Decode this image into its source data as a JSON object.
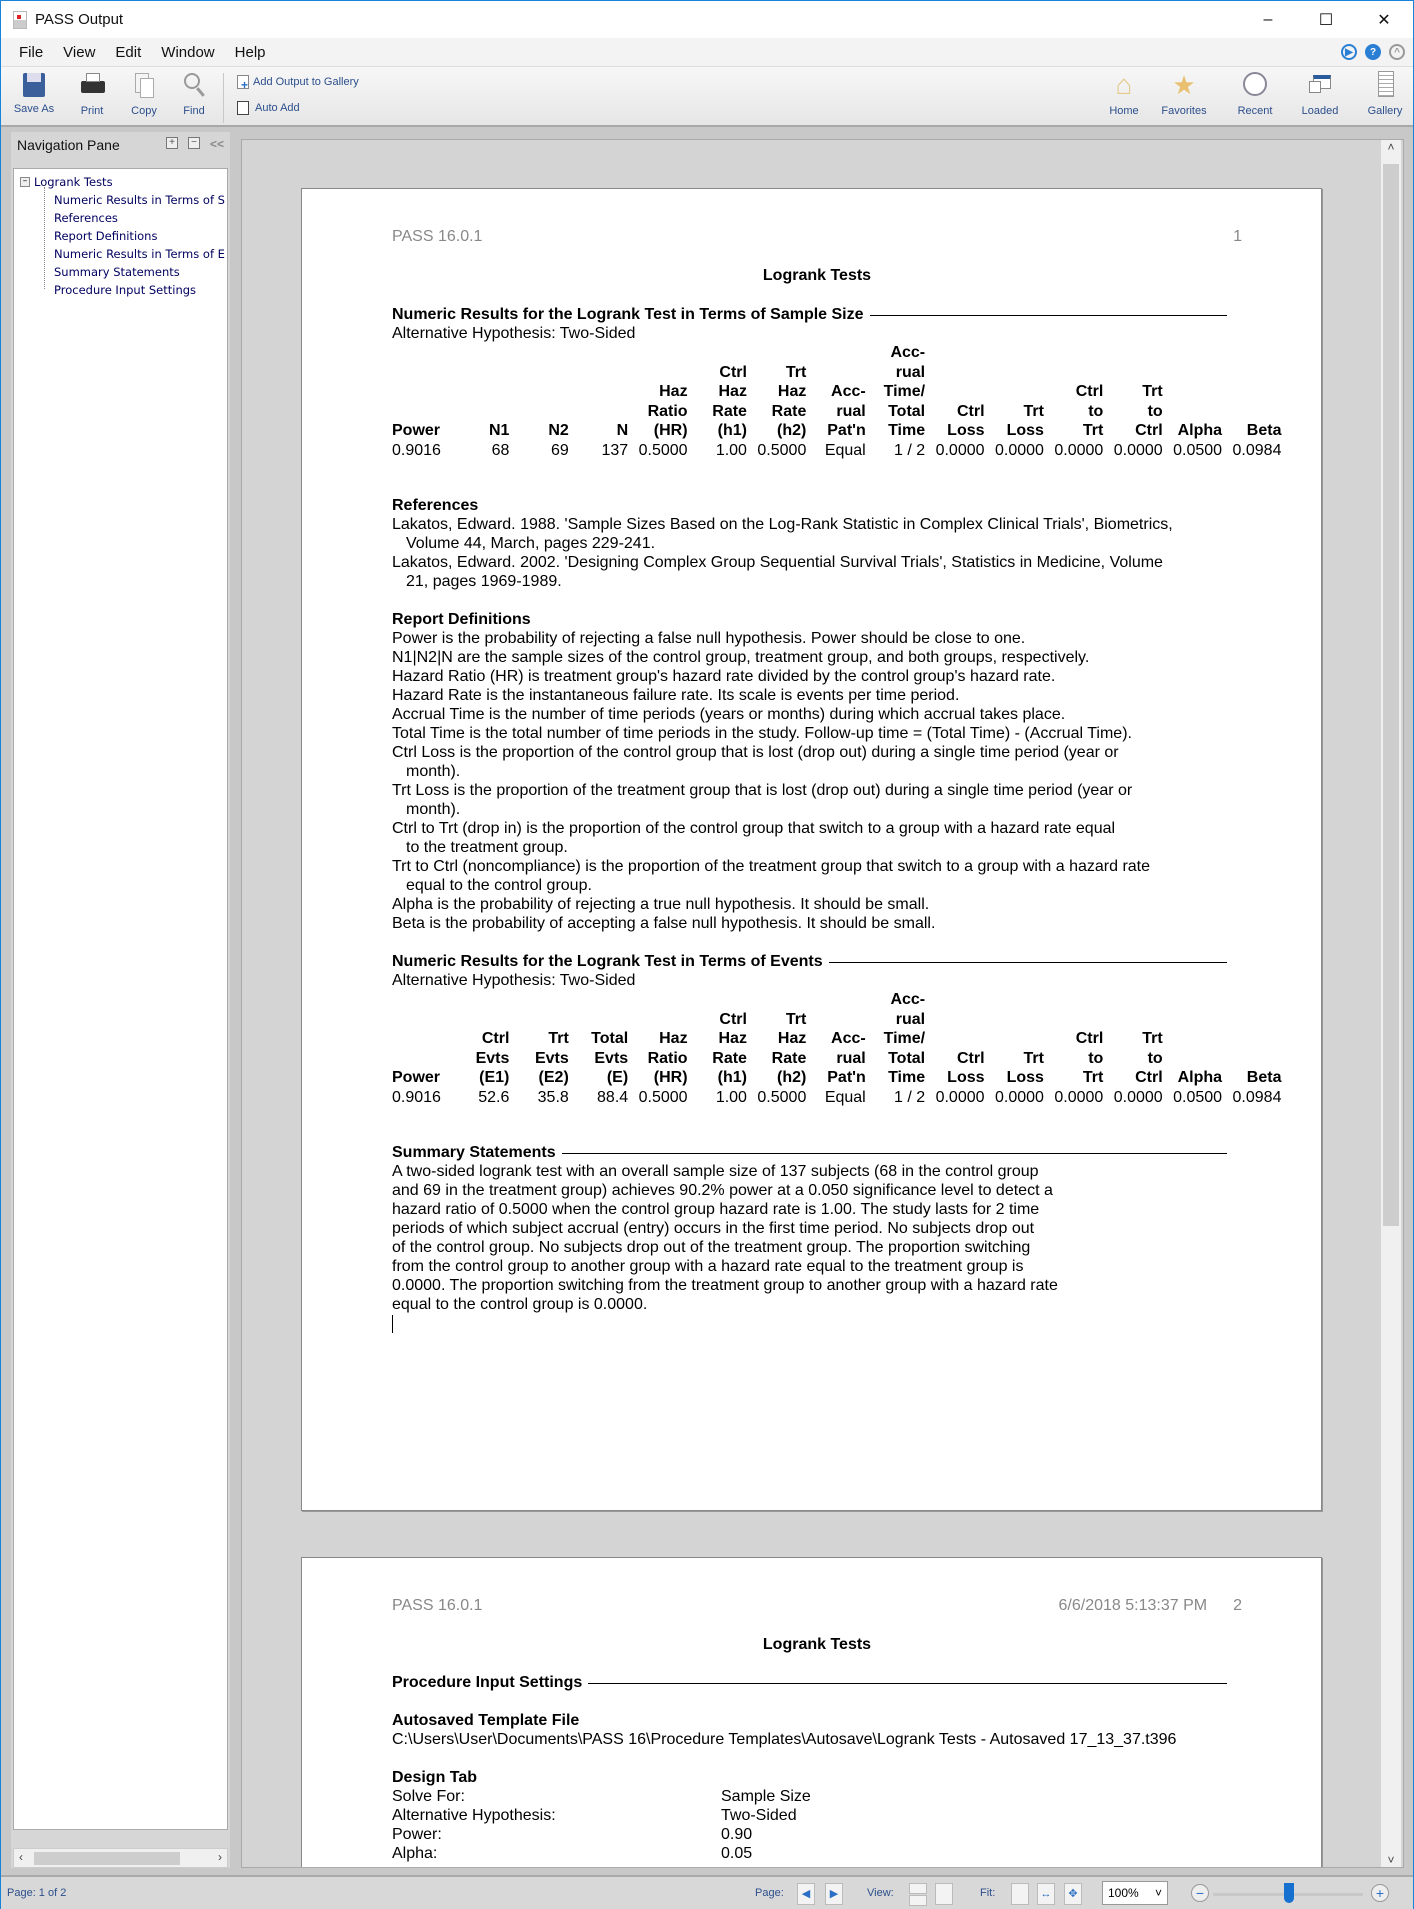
{
  "window": {
    "title": "PASS Output",
    "minimize": "–",
    "maximize": "☐",
    "close": "✕"
  },
  "menu": [
    "File",
    "View",
    "Edit",
    "Window",
    "Help"
  ],
  "toolbar": {
    "save_as": "Save As",
    "print": "Print",
    "copy": "Copy",
    "find": "Find",
    "add_output": "Add Output to Gallery",
    "auto_add": "Auto Add",
    "auto_add_checked": false,
    "home": "Home",
    "favorites": "Favorites",
    "recent": "Recent",
    "loaded": "Loaded",
    "gallery": "Gallery"
  },
  "nav": {
    "title": "Navigation Pane",
    "collapse": "<<",
    "root": "Logrank Tests",
    "items": [
      "Numeric Results in Terms of S",
      "References",
      "Report Definitions",
      "Numeric Results in Terms of E",
      "Summary Statements",
      "Procedure Input Settings"
    ]
  },
  "page1": {
    "version": "PASS 16.0.1",
    "page_num": "1",
    "title": "Logrank Tests",
    "sec1": "Numeric Results for the Logrank Test in Terms of Sample Size",
    "alt1": "Alternative Hypothesis: Two-Sided",
    "table1": {
      "headers": [
        "Power",
        "N1",
        "N2",
        "N",
        "Haz\nRatio\n(HR)",
        "Ctrl\nHaz\nRate\n(h1)",
        "Trt\nHaz\nRate\n(h2)",
        "Acc-\nrual\nPat'n",
        "Acc-\nrual\nTime/\nTotal\nTime",
        "Ctrl\nLoss",
        "Trt\nLoss",
        "Ctrl\nto\nTrt",
        "Trt\nto\nCtrl",
        "Alpha",
        "Beta"
      ],
      "row": [
        "0.9016",
        "68",
        "69",
        "137",
        "0.5000",
        "1.00",
        "0.5000",
        "Equal",
        "1 / 2",
        "0.0000",
        "0.0000",
        "0.0000",
        "0.0000",
        "0.0500",
        "0.0984"
      ]
    },
    "references_title": "References",
    "references": [
      {
        "text": "Lakatos, Edward. 1988. 'Sample Sizes Based on the Log-Rank Statistic in Complex Clinical Trials', Biometrics,",
        "indent": false
      },
      {
        "text": "Volume 44, March, pages 229-241.",
        "indent": true
      },
      {
        "text": "Lakatos, Edward. 2002. 'Designing Complex Group Sequential Survival Trials', Statistics in Medicine, Volume",
        "indent": false
      },
      {
        "text": "21, pages 1969-1989.",
        "indent": true
      }
    ],
    "defs_title": "Report Definitions",
    "defs": [
      {
        "text": "Power is the probability of rejecting a false null hypothesis. Power should be close to one.",
        "indent": false
      },
      {
        "text": "N1|N2|N are the sample sizes of the control group, treatment group, and both groups, respectively.",
        "indent": false
      },
      {
        "text": "Hazard Ratio (HR) is treatment group's hazard rate divided by the control group's hazard rate.",
        "indent": false
      },
      {
        "text": "Hazard Rate is the instantaneous failure rate. Its scale is events per time period.",
        "indent": false
      },
      {
        "text": "Accrual Time is the number of time periods (years or months) during which accrual takes place.",
        "indent": false
      },
      {
        "text": "Total Time is the total number of time periods in the study. Follow-up time = (Total Time) - (Accrual Time).",
        "indent": false
      },
      {
        "text": "Ctrl Loss is the proportion of the control group that is lost (drop out) during a single time period (year or",
        "indent": false
      },
      {
        "text": "month).",
        "indent": true
      },
      {
        "text": "Trt Loss is the proportion of the treatment group that is lost (drop out) during a single time period (year or",
        "indent": false
      },
      {
        "text": "month).",
        "indent": true
      },
      {
        "text": "Ctrl to Trt (drop in) is the proportion of the control group that switch to a group with a hazard rate equal",
        "indent": false
      },
      {
        "text": "to the treatment group.",
        "indent": true
      },
      {
        "text": "Trt to Ctrl (noncompliance) is the proportion of the treatment group that switch to a group with a hazard rate",
        "indent": false
      },
      {
        "text": "equal to the control group.",
        "indent": true
      },
      {
        "text": "Alpha is the probability of rejecting a true null hypothesis. It should be small.",
        "indent": false
      },
      {
        "text": "Beta is the probability of accepting a false null hypothesis. It should be small.",
        "indent": false
      }
    ],
    "sec2": "Numeric Results for the Logrank Test in Terms of Events",
    "alt2": "Alternative Hypothesis: Two-Sided",
    "table2": {
      "headers": [
        "Power",
        "Ctrl\nEvts\n(E1)",
        "Trt\nEvts\n(E2)",
        "Total\nEvts\n(E)",
        "Haz\nRatio\n(HR)",
        "Ctrl\nHaz\nRate\n(h1)",
        "Trt\nHaz\nRate\n(h2)",
        "Acc-\nrual\nPat'n",
        "Acc-\nrual\nTime/\nTotal\nTime",
        "Ctrl\nLoss",
        "Trt\nLoss",
        "Ctrl\nto\nTrt",
        "Trt\nto\nCtrl",
        "Alpha",
        "Beta"
      ],
      "row": [
        "0.9016",
        "52.6",
        "35.8",
        "88.4",
        "0.5000",
        "1.00",
        "0.5000",
        "Equal",
        "1 / 2",
        "0.0000",
        "0.0000",
        "0.0000",
        "0.0000",
        "0.0500",
        "0.0984"
      ]
    },
    "summary_title": "Summary Statements",
    "summary": [
      "A two-sided logrank test with an overall sample size of 137 subjects (68 in the control group",
      "and 69 in the treatment group) achieves 90.2% power at a 0.050 significance level to detect a",
      "hazard ratio of 0.5000 when the control group hazard rate is 1.00. The study lasts for 2 time",
      "periods of which subject accrual (entry) occurs in the first time period. No subjects drop out",
      "of the control group. No subjects drop out of the treatment group. The proportion switching",
      "from the control group to another group with a hazard rate equal to the treatment group is",
      "0.0000. The proportion switching from the treatment group to another group with a hazard rate",
      "equal to the control group is 0.0000."
    ]
  },
  "page2": {
    "version": "PASS 16.0.1",
    "datetime": "6/6/2018 5:13:37 PM",
    "page_num": "2",
    "title": "Logrank Tests",
    "sec": "Procedure Input Settings",
    "template_title": "Autosaved Template File",
    "template_path": "C:\\Users\\User\\Documents\\PASS 16\\Procedure Templates\\Autosave\\Logrank Tests - Autosaved 17_13_37.t396",
    "design_title": "Design Tab",
    "design": [
      {
        "k": "Solve For:",
        "v": "Sample Size"
      },
      {
        "k": "Alternative Hypothesis:",
        "v": "Two-Sided"
      },
      {
        "k": "Power:",
        "v": "0.90"
      },
      {
        "k": "Alpha:",
        "v": "0.05"
      }
    ]
  },
  "status": {
    "page": "Page: 1 of 2",
    "page_label": "Page:",
    "view_label": "View:",
    "fit_label": "Fit:",
    "zoom": "100%",
    "zoom_level_percent": 100
  }
}
